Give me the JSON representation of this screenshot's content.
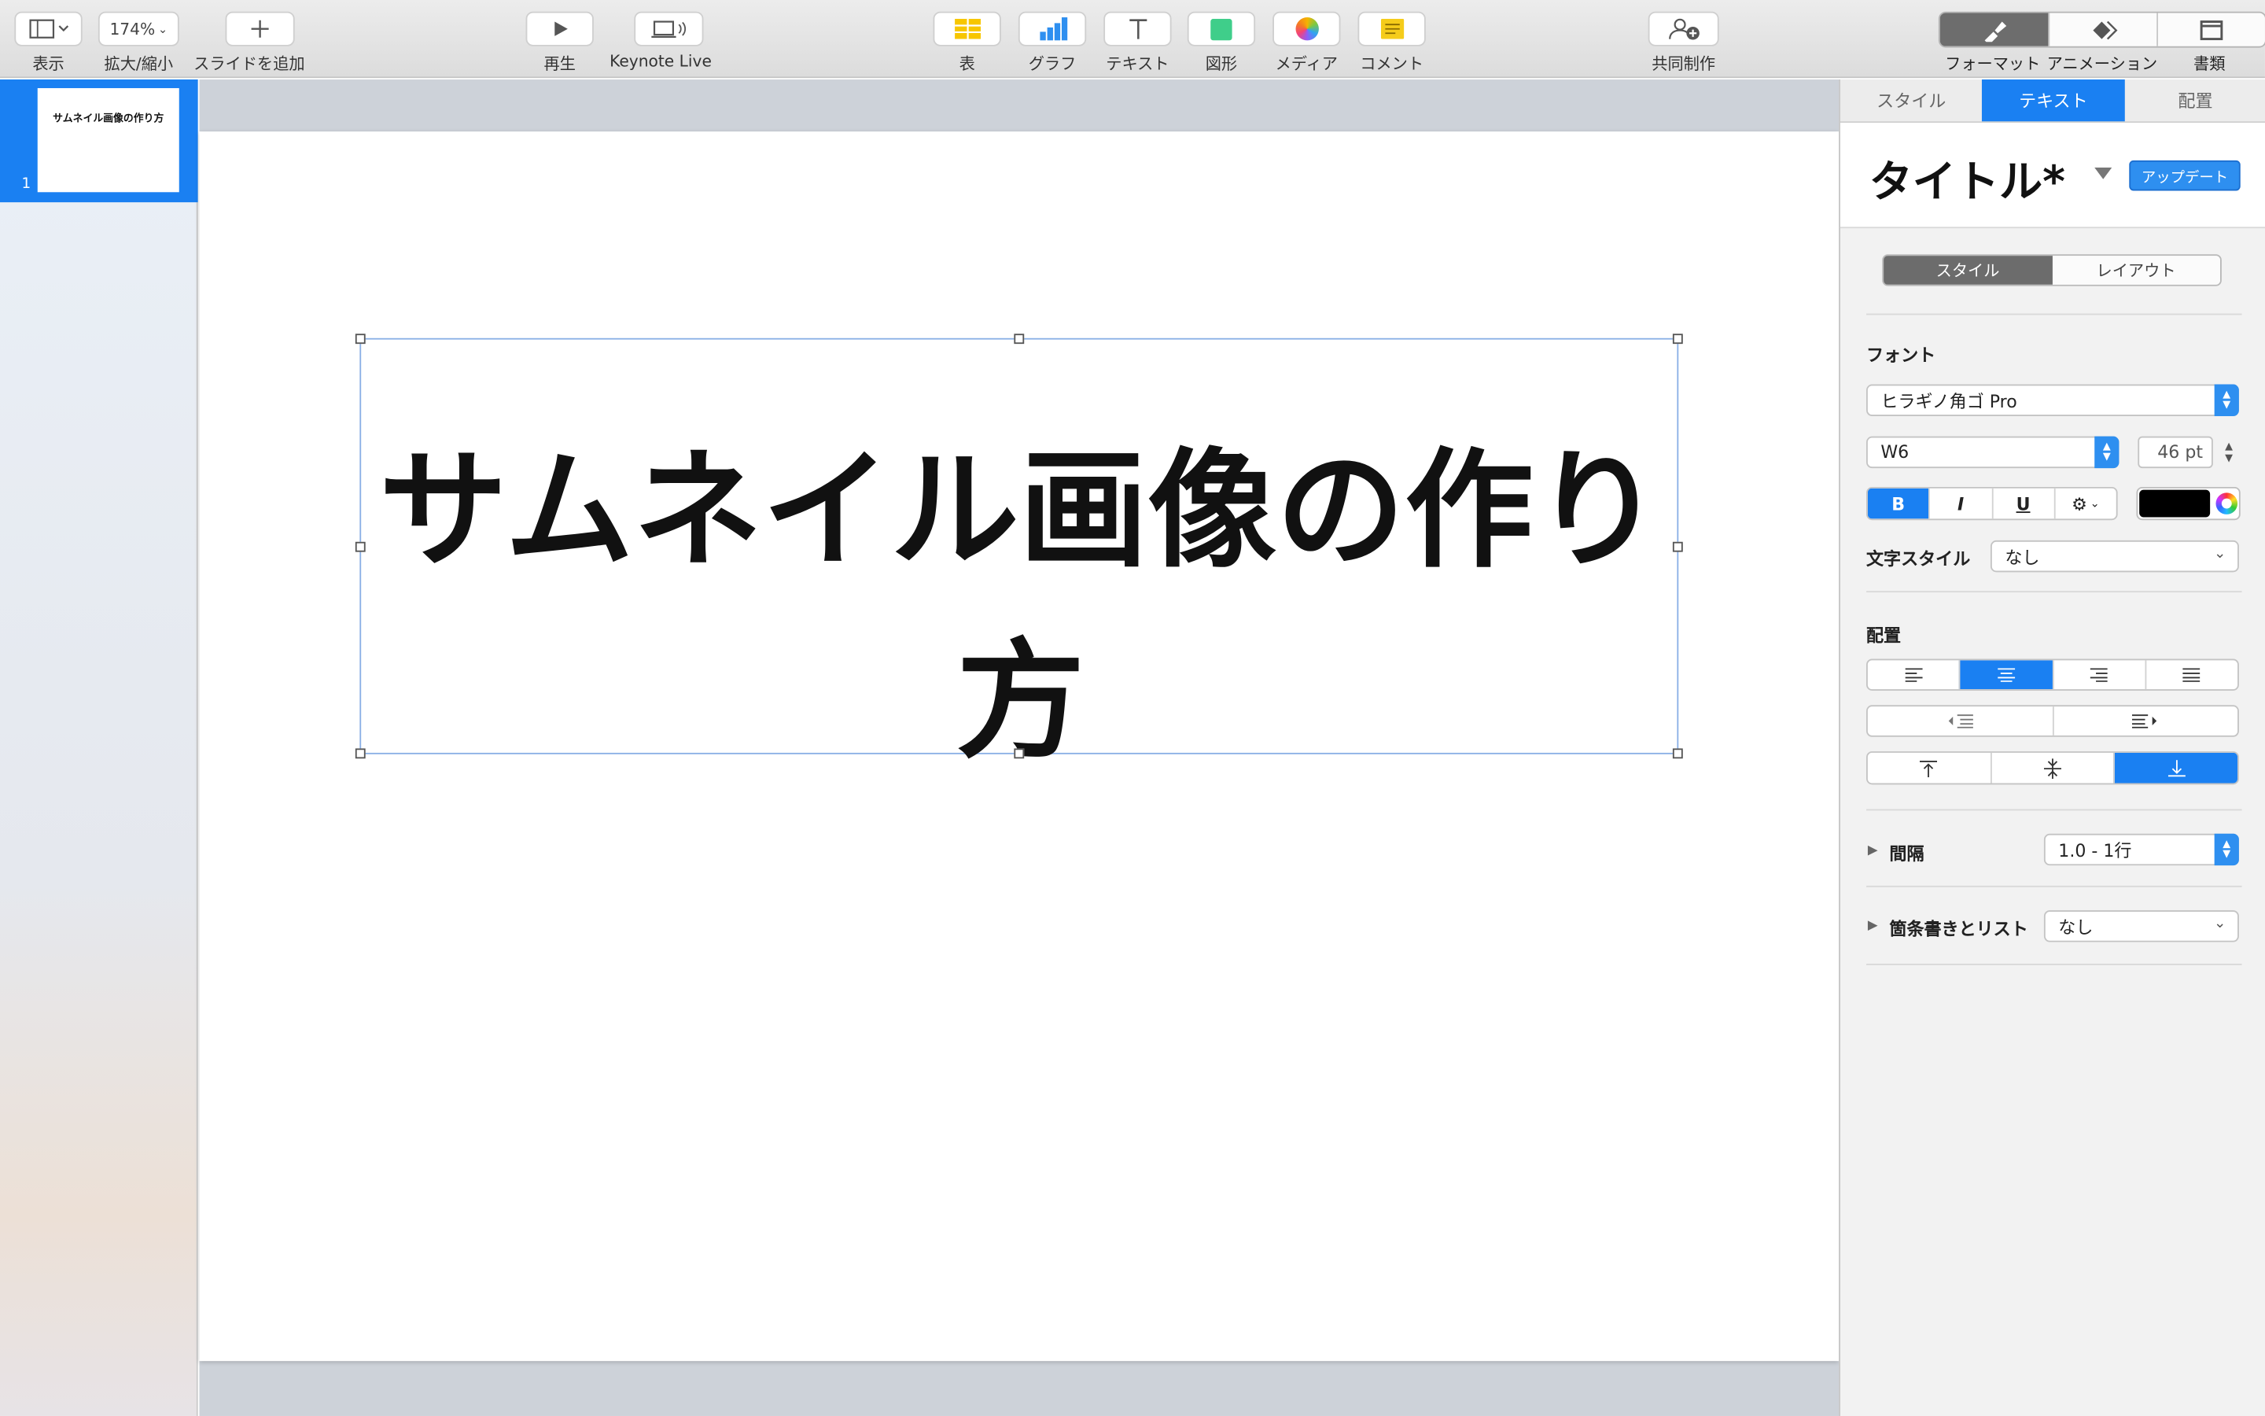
{
  "toolbar": {
    "view_label": "表示",
    "zoom_value": "174%",
    "zoom_label": "拡大/縮小",
    "add_slide_label": "スライドを追加",
    "play_label": "再生",
    "keynote_live_label": "Keynote Live",
    "table_label": "表",
    "chart_label": "グラフ",
    "text_label": "テキスト",
    "shape_label": "図形",
    "media_label": "メディア",
    "comment_label": "コメント",
    "collaborate_label": "共同制作",
    "format_label": "フォーマット",
    "animate_label": "アニメーション",
    "document_label": "書類"
  },
  "navigator": {
    "slides": [
      {
        "number": "1",
        "thumb_text": "サムネイル画像の作り方"
      }
    ]
  },
  "slide": {
    "title_line1": "サムネイル画像の作り",
    "title_line2": "方"
  },
  "inspector": {
    "tabs": [
      "スタイル",
      "テキスト",
      "配置"
    ],
    "active_tab": "テキスト",
    "paragraph_style": "タイトル*",
    "update_button": "アップデート",
    "sub_tabs": [
      "スタイル",
      "レイアウト"
    ],
    "font_section": "フォント",
    "font_family": "ヒラギノ角ゴ Pro",
    "font_weight": "W6",
    "font_size": "46 pt",
    "style_buttons": [
      "B",
      "I",
      "U"
    ],
    "text_color": "#000000",
    "char_style_label": "文字スタイル",
    "char_style_value": "なし",
    "alignment_section": "配置",
    "spacing_label": "間隔",
    "spacing_value": "1.0 - 1行",
    "bullets_label": "箇条書きとリスト",
    "bullets_value": "なし"
  },
  "colors": {
    "accent": "#1a80f2",
    "selected_toolbar_segment": "#6d6d6d"
  }
}
